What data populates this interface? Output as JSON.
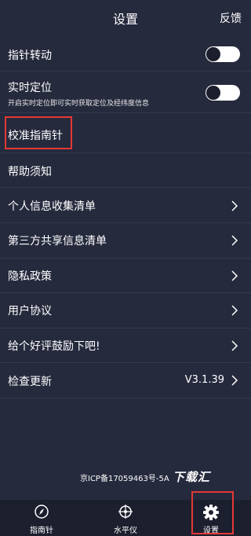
{
  "header": {
    "title": "设置",
    "feedback_label": "反馈"
  },
  "settings": {
    "pointer_rotation": {
      "label": "指针转动",
      "enabled": false
    },
    "realtime_location": {
      "label": "实时定位",
      "description": "开启实时定位即可实时获取定位及经纬度信息",
      "enabled": false
    },
    "calibrate": {
      "label": "校准指南针"
    },
    "help": {
      "label": "帮助须知"
    },
    "personal_info": {
      "label": "个人信息收集清单"
    },
    "third_party": {
      "label": "第三方共享信息清单"
    },
    "privacy": {
      "label": "隐私政策"
    },
    "user_agreement": {
      "label": "用户协议"
    },
    "rating": {
      "label": "给个好评鼓励下吧!"
    },
    "check_update": {
      "label": "检查更新",
      "version": "V3.1.39"
    }
  },
  "footer": {
    "icp": "京ICP备17059463号-5A",
    "watermark": "下载汇"
  },
  "tabs": [
    {
      "label": "指南针",
      "icon": "compass-icon"
    },
    {
      "label": "水平仪",
      "icon": "level-icon"
    },
    {
      "label": "设置",
      "icon": "gear-icon",
      "active": true
    }
  ],
  "colors": {
    "background": "#262a3d",
    "tabbar": "#1c1f2e",
    "highlight": "#e53935"
  }
}
